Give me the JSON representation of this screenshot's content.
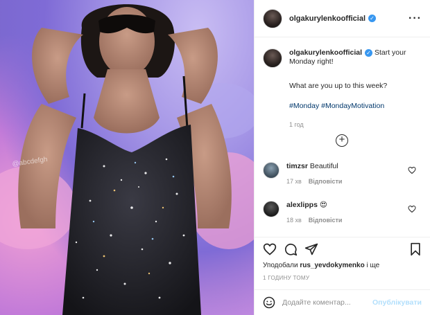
{
  "post": {
    "username": "olgakurylenkoofficial",
    "verified_mark": "✓",
    "more_icon": "more-horizontal-icon"
  },
  "caption": {
    "username": "olgakurylenkoofficial",
    "line1": "Start your Monday right!",
    "line2": "What are you up to this week?",
    "hashtags": "#Monday #MondayMotivation",
    "time": "1 год"
  },
  "load_more_icon": "plus-circle-icon",
  "comments": [
    {
      "username": "timzsr",
      "text": "Beautiful",
      "time": "17 хв",
      "reply": "Відповісти"
    },
    {
      "username": "alexlipps",
      "text": "😍",
      "time": "18 хв",
      "reply": "Відповісти"
    }
  ],
  "actions": {
    "like_icon": "heart-icon",
    "comment_icon": "comment-icon",
    "share_icon": "paper-plane-icon",
    "save_icon": "bookmark-icon"
  },
  "likes": {
    "prefix": "Уподобали",
    "user": "rus_yevdokymenko",
    "suffix": "і ще"
  },
  "posted_ago": "1 ГОДИНУ ТОМУ",
  "add_comment": {
    "placeholder": "Додайте коментар...",
    "publish": "Опублікувати",
    "emoji_icon": "emoji-smile-icon"
  },
  "photo_watermark": "@abcdefgh",
  "colors": {
    "link": "#00376b",
    "verified": "#3897f0",
    "publish_disabled": "#b2dffc",
    "muted": "#8e8e8e"
  }
}
